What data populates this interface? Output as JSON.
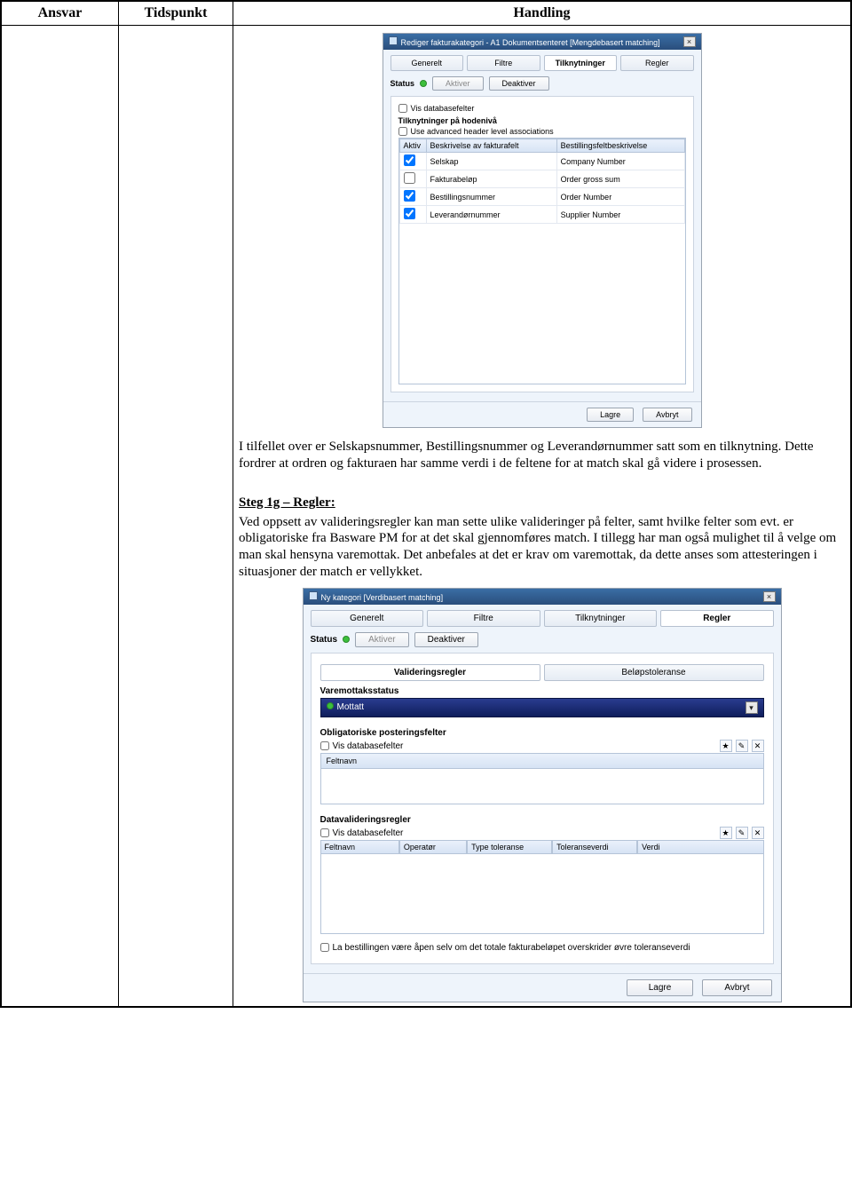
{
  "table_headers": [
    "Ansvar",
    "Tidspunkt",
    "Handling"
  ],
  "dialog1": {
    "title": "Rediger fakturakategori - A1 Dokumentsenteret [Mengdebasert matching]",
    "close": "×",
    "tabs": [
      "Generelt",
      "Filtre",
      "Tilknytninger",
      "Regler"
    ],
    "active_tab_index": 2,
    "status_label": "Status",
    "btn_activate": "Aktiver",
    "btn_deactivate": "Deaktiver",
    "chk_vis_db": "Vis databasefelter",
    "section_title": "Tilknytninger på hodenivå",
    "chk_advanced": "Use advanced header level associations",
    "grid_headers": [
      "Aktiv",
      "Beskrivelse av fakturafelt",
      "Bestillingsfeltbeskrivelse"
    ],
    "rows": [
      {
        "active": true,
        "a": "Selskap",
        "b": "Company Number"
      },
      {
        "active": false,
        "a": "Fakturabeløp",
        "b": "Order gross sum"
      },
      {
        "active": true,
        "a": "Bestillingsnummer",
        "b": "Order Number"
      },
      {
        "active": true,
        "a": "Leverandørnummer",
        "b": "Supplier Number"
      }
    ],
    "btn_save": "Lagre",
    "btn_cancel": "Avbryt"
  },
  "para1": "I tilfellet over er Selskapsnummer, Bestillingsnummer og Leverandørnummer satt som en tilknytning. Dette fordrer at ordren og fakturaen har samme verdi i de feltene for at match skal gå videre i prosessen.",
  "step_head": "Steg 1g – Regler:",
  "para2": "Ved oppsett av valideringsregler kan man sette ulike valideringer på felter, samt hvilke felter som evt. er obligatoriske fra Basware PM for at det skal gjennomføres match. I tillegg har man også mulighet til å velge om man skal hensyna varemottak. Det anbefales at det er krav om varemottak, da dette anses som attesteringen i situasjoner der match er vellykket.",
  "dialog2": {
    "title": "Ny kategori [Verdibasert matching]",
    "close": "×",
    "tabs": [
      "Generelt",
      "Filtre",
      "Tilknytninger",
      "Regler"
    ],
    "active_tab_index": 3,
    "status_label": "Status",
    "btn_activate": "Aktiver",
    "btn_deactivate": "Deaktiver",
    "subtabs": [
      "Valideringsregler",
      "Beløpstoleranse"
    ],
    "active_subtab_index": 0,
    "sec_varemottak": "Varemottaksstatus",
    "sel_value": "Mottatt",
    "sec_oblig": "Obligatoriske posteringsfelter",
    "chk_vis_db": "Vis databasefelter",
    "hdr_feltnavn": "Feltnavn",
    "sec_dataval": "Datavalideringsregler",
    "grid_headers": [
      "Feltnavn",
      "Operatør",
      "Type toleranse",
      "Toleranseverdi",
      "Verdi"
    ],
    "chk_la_bestilling": "La bestillingen være åpen selv om det totale fakturabeløpet overskrider øvre toleranseverdi",
    "icon_star": "★",
    "icon_edit": "✎",
    "icon_del": "✕",
    "dd": "▾",
    "btn_save": "Lagre",
    "btn_cancel": "Avbryt"
  }
}
